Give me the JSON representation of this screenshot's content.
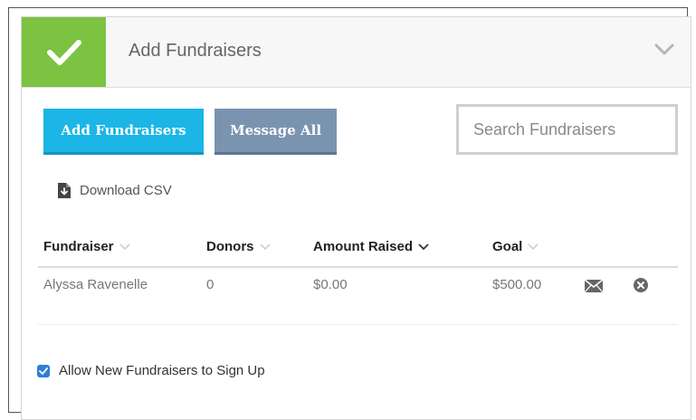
{
  "section": {
    "title": "Add Fundraisers",
    "status_icon": "check-icon",
    "collapse_icon": "chevron-down-icon"
  },
  "toolbar": {
    "add_label": "Add Fundraisers",
    "message_all_label": "Message All",
    "search_placeholder": "Search Fundraisers",
    "search_value": ""
  },
  "download": {
    "label": "Download CSV",
    "icon": "download-file-icon"
  },
  "table": {
    "columns": [
      {
        "label": "Fundraiser",
        "sort": "inactive"
      },
      {
        "label": "Donors",
        "sort": "inactive"
      },
      {
        "label": "Amount Raised",
        "sort": "active"
      },
      {
        "label": "Goal",
        "sort": "inactive"
      }
    ],
    "rows": [
      {
        "fundraiser": "Alyssa Ravenelle",
        "donors": "0",
        "amount_raised": "$0.00",
        "goal": "$500.00"
      }
    ]
  },
  "allow_signup": {
    "label": "Allow New Fundraisers to Sign Up",
    "checked": true
  },
  "colors": {
    "success_green": "#7cc341",
    "primary_blue": "#1bb5e6",
    "secondary_slate": "#7a94b0",
    "checkbox_blue": "#2f7fd6"
  }
}
